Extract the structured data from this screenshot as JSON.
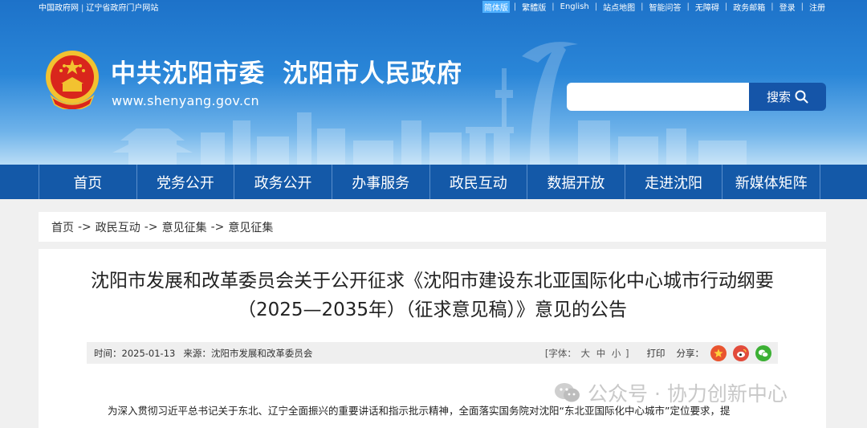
{
  "topbar": {
    "left": [
      "中国政府网",
      "辽宁省政府门户网站"
    ],
    "right": [
      "简体版",
      "繁體版",
      "English",
      "站点地图",
      "智能问答",
      "无障碍",
      "政务邮箱",
      "登录",
      "注册"
    ],
    "active_index": 0
  },
  "header": {
    "title_part1": "中共沈阳市委",
    "title_part2": "沈阳市人民政府",
    "url": "www.shenyang.gov.cn",
    "search_placeholder": "",
    "search_button": "搜索"
  },
  "nav": {
    "items": [
      "首页",
      "党务公开",
      "政务公开",
      "办事服务",
      "政民互动",
      "数据开放",
      "走进沈阳",
      "新媒体矩阵"
    ]
  },
  "breadcrumb": {
    "items": [
      "首页",
      "政民互动",
      "意见征集",
      "意见征集"
    ],
    "separator": "->"
  },
  "article": {
    "title": "沈阳市发展和改革委员会关于公开征求《沈阳市建设东北亚国际化中心城市行动纲要（2025—2035年）（征求意见稿）》意见的公告",
    "time_label": "时间：",
    "time": "2025-01-13",
    "source_label": "来源：",
    "source": "沈阳市发展和改革委员会",
    "font_label_open": "[字体：",
    "font_sizes": [
      "大",
      "中",
      "小"
    ],
    "font_label_close": "]",
    "print": "打印",
    "share_label": "分享：",
    "body": "为深入贯彻习近平总书记关于东北、辽宁全面振兴的重要讲话和指示批示精神，全面落实国务院对沈阳“东北亚国际化中心城市”定位要求，提"
  },
  "share_icons": [
    {
      "name": "qzone-icon",
      "color": "#e9542f"
    },
    {
      "name": "weibo-icon",
      "color": "#e24b3b"
    },
    {
      "name": "wechat-icon",
      "color": "#3cb034"
    }
  ],
  "watermark": {
    "text": "公众号 · 协力创新中心"
  },
  "colors": {
    "nav_bg": "#1459a8",
    "search_btn": "#1555a8",
    "header_top": "#1d72c9"
  }
}
